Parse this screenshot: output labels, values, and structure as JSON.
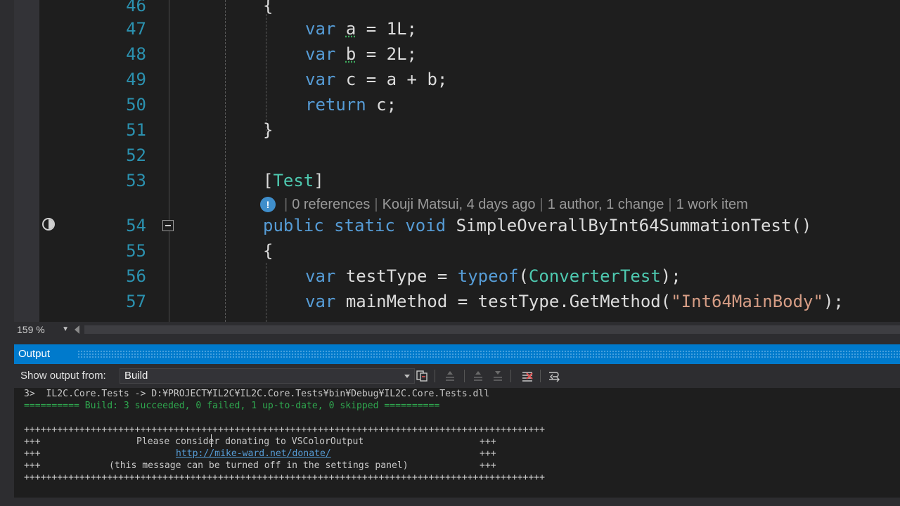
{
  "editor": {
    "lines": [
      {
        "num": "46",
        "code": "{"
      },
      {
        "num": "47",
        "code": "var a = 1L;"
      },
      {
        "num": "48",
        "code": "var b = 2L;"
      },
      {
        "num": "49",
        "code": "var c = a + b;"
      },
      {
        "num": "50",
        "code": "return c;"
      },
      {
        "num": "51",
        "code": "}"
      },
      {
        "num": "52",
        "code": ""
      },
      {
        "num": "53",
        "code": "[Test]"
      },
      {
        "num": "54",
        "code": "public static void SimpleOverallByInt64SummationTest()"
      },
      {
        "num": "55",
        "code": "{"
      },
      {
        "num": "56",
        "code": "var testType = typeof(ConverterTest);"
      },
      {
        "num": "57",
        "code": "var mainMethod = testType.GetMethod(\"Int64MainBody\");"
      }
    ],
    "tokens": {
      "var": "var",
      "a": "a",
      "b": "b",
      "c": "c",
      "eq": "=",
      "plus": "+",
      "semi": ";",
      "one_l": "1L;",
      "two_l": "2L;",
      "c_semi": "c;",
      "return": "return",
      "lbrace": "{",
      "rbrace": "}",
      "attr_open": "[",
      "attr_name": "Test",
      "attr_close": "]",
      "public": "public",
      "static": "static",
      "void": "void",
      "method_name": "SimpleOverallByInt64SummationTest()",
      "testType": "testType",
      "typeof": "typeof",
      "paren_open": "(",
      "converter": "ConverterTest",
      "close_semi": ");",
      "mainMethod": "mainMethod",
      "getmethod": "testType.GetMethod(",
      "str": "\"Int64MainBody\""
    },
    "codelens": {
      "references": "0 references",
      "author": "Kouji Matsui, 4 days ago",
      "changes": "1 author, 1 change",
      "work_items": "1 work item",
      "separator": "|"
    },
    "zoom": "159 %"
  },
  "output_panel": {
    "title": "Output",
    "show_from_label": "Show output from:",
    "source": "Build",
    "toolbar_icons": [
      "find-message-icon",
      "previous-message-icon",
      "next-message-icon",
      "next-message-alt-icon",
      "clear-all-icon",
      "toggle-word-wrap-icon"
    ],
    "lines": [
      "3>  IL2C.Core.Tests -> D:¥PROJECT¥IL2C¥IL2C.Core.Tests¥bin¥Debug¥IL2C.Core.Tests.dll",
      "========== Build: 3 succeeded, 0 failed, 1 up-to-date, 0 skipped ==========",
      "",
      "++++++++++++++++++++++++++++++++++++++++++++++++++++++++++++++++++++++++++++++++++++++++++++++",
      "+++",
      "Please consider donating to VSColorOutput",
      "+++",
      "+++",
      "http://mike-ward.net/donate/",
      "+++",
      "+++",
      "(this message can be turned off in the settings panel)",
      "+++",
      "++++++++++++++++++++++++++++++++++++++++++++++++++++++++++++++++++++++++++++++++++++++++++++++"
    ]
  },
  "colors": {
    "accent": "#007acc",
    "keyword": "#569cd6",
    "type": "#4ec9b0",
    "string": "#d69d85",
    "line_number": "#2b91af",
    "success": "#2fa84f"
  }
}
